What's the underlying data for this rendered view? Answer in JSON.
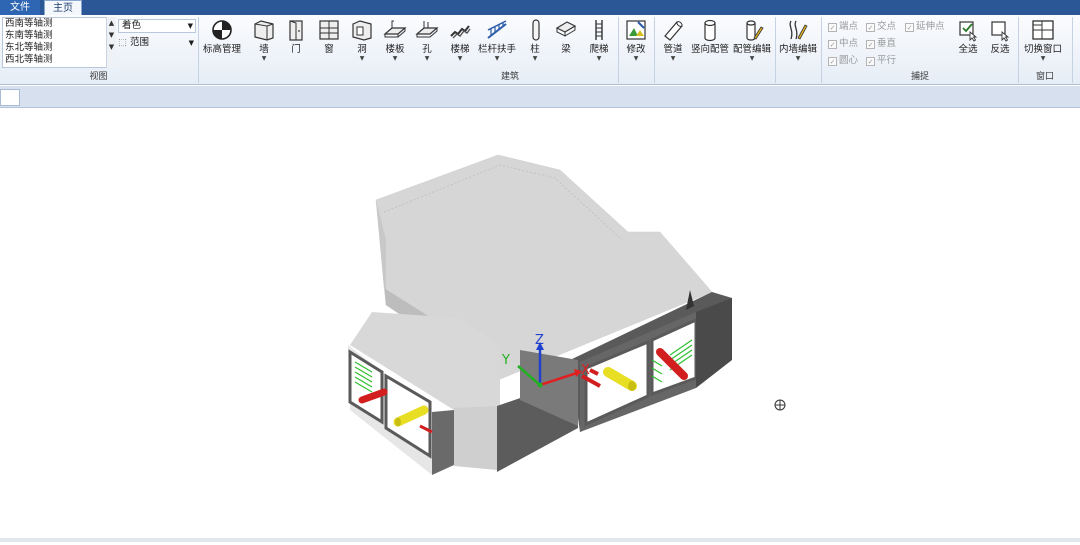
{
  "tabs": {
    "file": "文件",
    "home": "主页"
  },
  "view_group": {
    "label": "视图",
    "views": [
      "西南等轴测",
      "东南等轴测",
      "东北等轴测",
      "西北等轴测"
    ],
    "render_mode": "着色",
    "range_label": "范围"
  },
  "architecture_group": {
    "label": "建筑",
    "buttons": {
      "elevation": "标高管理",
      "wall": "墙",
      "door": "门",
      "window": "窗",
      "opening": "洞",
      "slab": "楼板",
      "hole": "孔",
      "stair": "楼梯",
      "railing": "栏杆扶手",
      "column": "柱",
      "beam": "梁",
      "ladder": "爬梯",
      "modify": "修改",
      "pipe": "管道",
      "vertical_pipe": "竖向配管",
      "pipe_edit": "配管编辑",
      "inner_wall_edit": "内墙编辑"
    }
  },
  "snap_group": {
    "label": "捕捉",
    "options": {
      "endpoint": "端点",
      "intersection": "交点",
      "extension": "延伸点",
      "midpoint": "中点",
      "perpendicular": "垂直",
      "center": "圆心",
      "parallel": "平行"
    },
    "select_all": "全选",
    "invert": "反选"
  },
  "window_group": {
    "label": "窗口",
    "switch_window": "切换窗口"
  },
  "axis_labels": {
    "x": "X",
    "y": "Y",
    "z": "Z"
  },
  "colors": {
    "tab_bar": "#2b5797",
    "model_top": "#dcdcdc",
    "model_side": "#5a5a5a",
    "pipe_red": "#d21e1e",
    "pipe_yellow": "#e8de24",
    "hanger_green": "#2fbf2f",
    "axis_x": "#e02020",
    "axis_y": "#20b020",
    "axis_z": "#2040d0"
  },
  "icons": [
    "wall-icon",
    "door-icon",
    "window-icon",
    "opening-icon",
    "slab-icon",
    "hole-icon",
    "stair-icon",
    "railing-icon",
    "column-icon",
    "beam-icon",
    "ladder-icon",
    "modify-icon",
    "pipe-icon",
    "vertical-pipe-icon",
    "pipe-edit-icon",
    "inner-wall-edit-icon",
    "select-all-icon",
    "invert-select-icon",
    "switch-window-icon",
    "orbit-cursor-icon"
  ]
}
